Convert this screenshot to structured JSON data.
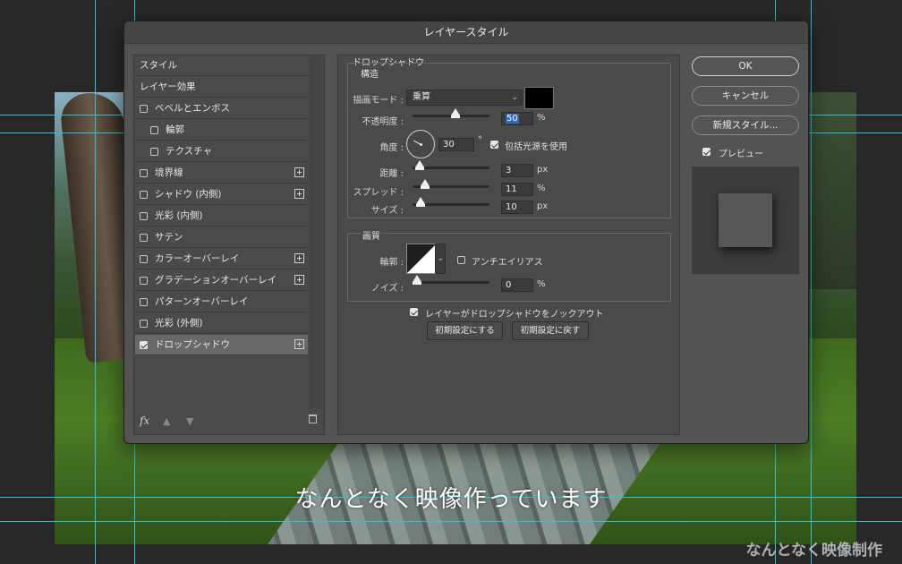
{
  "dialog": {
    "title": "レイヤースタイル"
  },
  "left_list": {
    "items": [
      {
        "label": "スタイル",
        "checkbox": false,
        "checked": false,
        "plus": false,
        "indent": false,
        "selected": false
      },
      {
        "label": "レイヤー効果",
        "checkbox": false,
        "checked": false,
        "plus": false,
        "indent": false,
        "selected": false
      },
      {
        "label": "ベベルとエンボス",
        "checkbox": true,
        "checked": false,
        "plus": false,
        "indent": false,
        "selected": false
      },
      {
        "label": "輪郭",
        "checkbox": true,
        "checked": false,
        "plus": false,
        "indent": true,
        "selected": false
      },
      {
        "label": "テクスチャ",
        "checkbox": true,
        "checked": false,
        "plus": false,
        "indent": true,
        "selected": false
      },
      {
        "label": "境界線",
        "checkbox": true,
        "checked": false,
        "plus": true,
        "indent": false,
        "selected": false
      },
      {
        "label": "シャドウ (内側)",
        "checkbox": true,
        "checked": false,
        "plus": true,
        "indent": false,
        "selected": false
      },
      {
        "label": "光彩 (内側)",
        "checkbox": true,
        "checked": false,
        "plus": false,
        "indent": false,
        "selected": false
      },
      {
        "label": "サテン",
        "checkbox": true,
        "checked": false,
        "plus": false,
        "indent": false,
        "selected": false
      },
      {
        "label": "カラーオーバーレイ",
        "checkbox": true,
        "checked": false,
        "plus": true,
        "indent": false,
        "selected": false
      },
      {
        "label": "グラデーションオーバーレイ",
        "checkbox": true,
        "checked": false,
        "plus": true,
        "indent": false,
        "selected": false
      },
      {
        "label": "パターンオーバーレイ",
        "checkbox": true,
        "checked": false,
        "plus": false,
        "indent": false,
        "selected": false
      },
      {
        "label": "光彩 (外側)",
        "checkbox": true,
        "checked": false,
        "plus": false,
        "indent": false,
        "selected": false
      },
      {
        "label": "ドロップシャドウ",
        "checkbox": true,
        "checked": true,
        "plus": true,
        "indent": false,
        "selected": true
      }
    ],
    "fx_label": "fx",
    "icons": [
      "fx-menu-icon",
      "move-up-icon",
      "move-down-icon",
      "trash-icon"
    ]
  },
  "drop_shadow": {
    "panel_title": "ドロップシャドウ",
    "structure_title": "構造",
    "blend_mode_label": "描画モード :",
    "blend_mode_value": "乗算",
    "shadow_color": "#000000",
    "opacity_label": "不透明度 :",
    "opacity_value": "50",
    "opacity_unit": "%",
    "angle_label": "角度 :",
    "angle_value": "30",
    "angle_unit": "°",
    "global_light_label": "包括光源を使用",
    "global_light_checked": true,
    "distance_label": "距離 :",
    "distance_value": "3",
    "distance_unit": "px",
    "spread_label": "スプレッド :",
    "spread_value": "11",
    "spread_unit": "%",
    "size_label": "サイズ :",
    "size_value": "10",
    "size_unit": "px",
    "quality_title": "画質",
    "contour_label": "輪郭 :",
    "antialias_label": "アンチエイリアス",
    "antialias_checked": false,
    "noise_label": "ノイズ :",
    "noise_value": "0",
    "noise_unit": "%",
    "knockout_label": "レイヤーがドロップシャドウをノックアウト",
    "knockout_checked": true,
    "make_default_label": "初期設定にする",
    "reset_default_label": "初期設定に戻す",
    "slider_levels": {
      "opacity": 0.5,
      "distance": 0.03,
      "spread": 0.11,
      "size": 0.05,
      "noise": 0.0
    }
  },
  "right_panel": {
    "ok_label": "OK",
    "cancel_label": "キャンセル",
    "new_style_label": "新規スタイル...",
    "preview_label": "プレビュー",
    "preview_checked": true
  },
  "canvas": {
    "subtitle": "なんとなく映像作っています",
    "watermark": "なんとなく映像制作"
  },
  "colors": {
    "guide": "#2ec3d6",
    "dialog_bg": "#535353",
    "selected_item": "#686868",
    "highlight": "#2f6ac0"
  }
}
